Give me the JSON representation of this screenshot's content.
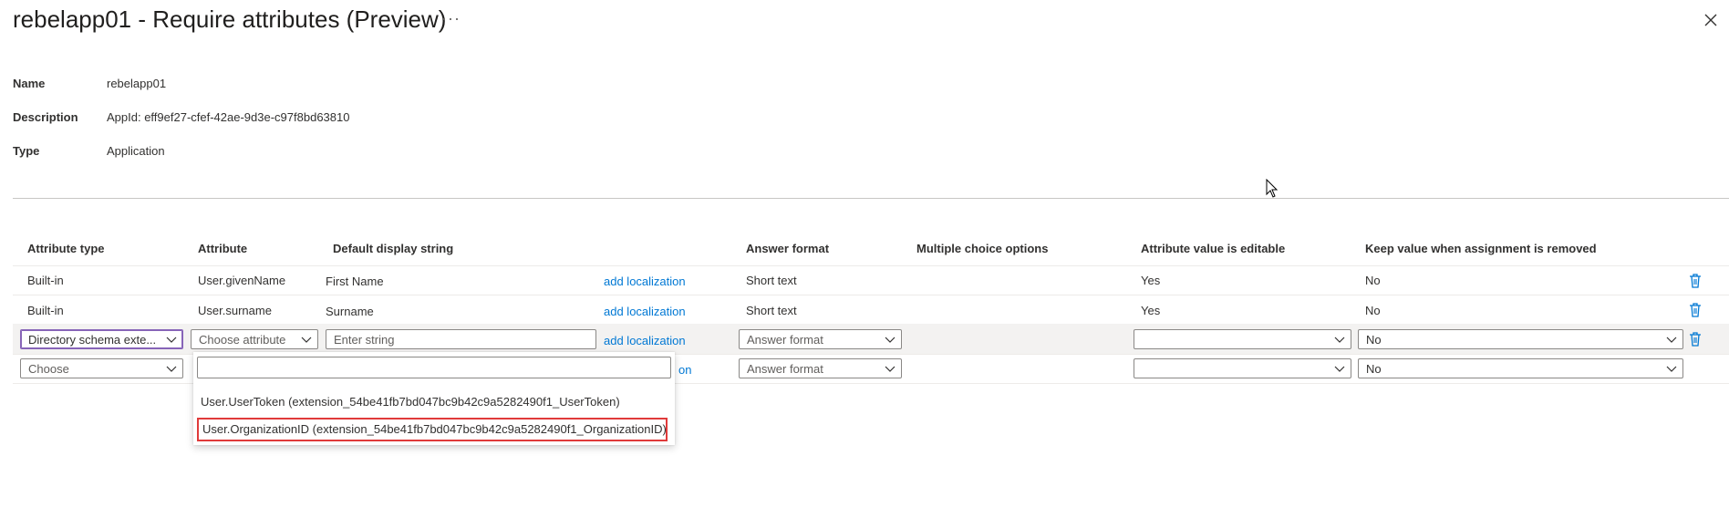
{
  "header": {
    "title": "rebelapp01 - Require attributes (Preview)",
    "more": "···"
  },
  "properties": [
    {
      "label": "Name",
      "value": "rebelapp01"
    },
    {
      "label": "Description",
      "value": "AppId: eff9ef27-cfef-42ae-9d3e-c97f8bd63810"
    },
    {
      "label": "Type",
      "value": "Application"
    }
  ],
  "table": {
    "columns": [
      "Attribute type",
      "Attribute",
      "Default display string",
      "Answer format",
      "Multiple choice options",
      "Attribute value is editable",
      "Keep value when assignment is removed"
    ],
    "rows": [
      {
        "type": "Built-in",
        "attribute": "User.givenName",
        "display": "First Name",
        "localization": "add localization",
        "format": "Short text",
        "editable": "Yes",
        "keep": "No"
      },
      {
        "type": "Built-in",
        "attribute": "User.surname",
        "display": "Surname",
        "localization": "add localization",
        "format": "Short text",
        "editable": "Yes",
        "keep": "No"
      }
    ],
    "edit_row": {
      "type_value": "Directory schema exte...",
      "attribute_placeholder": "Choose attribute",
      "display_placeholder": "Enter string",
      "localization": "add localization",
      "format_placeholder": "Answer format",
      "editable_value": "",
      "keep_value": "No"
    },
    "new_row": {
      "type_placeholder": "Choose",
      "localization_partial": "on",
      "format_placeholder": "Answer format",
      "editable_value": "",
      "keep_value": "No"
    }
  },
  "attribute_dropdown": {
    "search_value": "",
    "options": [
      "User.UserToken (extension_54be41fb7bd047bc9b42c9a5282490f1_UserToken)",
      "User.OrganizationID (extension_54be41fb7bd047bc9b42c9a5282490f1_OrganizationID)"
    ],
    "highlighted_index": 1
  },
  "colors": {
    "accent": "#0078d4",
    "focus": "#8764b8",
    "highlight": "#e03a3a"
  }
}
